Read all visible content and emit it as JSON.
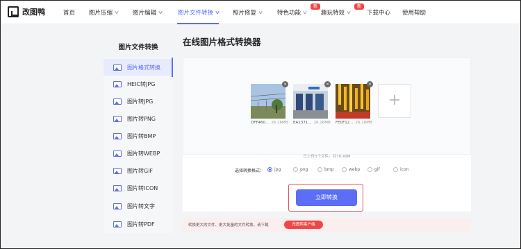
{
  "app": {
    "logo_text": "改图鸭"
  },
  "nav": {
    "items": [
      {
        "label": "首页"
      },
      {
        "label": "图片压缩"
      },
      {
        "label": "图片编辑"
      },
      {
        "label": "图片文件转换"
      },
      {
        "label": "照片修复"
      },
      {
        "label": "特色功能",
        "badge": "新"
      },
      {
        "label": "趣玩特效",
        "badge": "新"
      },
      {
        "label": "下载中心"
      },
      {
        "label": "使用帮助"
      }
    ],
    "active_index": 3
  },
  "sidebar": {
    "title": "图片文件转换",
    "items": [
      {
        "label": "图片格式转换"
      },
      {
        "label": "HEIC转JPG"
      },
      {
        "label": "图片转JPG"
      },
      {
        "label": "图片转PNG"
      },
      {
        "label": "图片转BMP"
      },
      {
        "label": "图片转WEBP"
      },
      {
        "label": "图片转GIF"
      },
      {
        "label": "图片转ICON"
      },
      {
        "label": "图片转文字"
      },
      {
        "label": "图片转PDF"
      }
    ],
    "active_index": 0
  },
  "main": {
    "title": "在线图片格式转换器",
    "files": [
      {
        "name": "DFF460...",
        "size": "26.16MB"
      },
      {
        "name": "EA1371...",
        "size": "26.16MB"
      },
      {
        "name": "FE0F12...",
        "size": "26.16MB"
      }
    ],
    "add_symbol": "+",
    "upload_info": "已上传3个文件，共78.49M",
    "format_label": "选择转换格式：",
    "formats": [
      "jpg",
      "png",
      "bmp",
      "webp",
      "gif",
      "icon"
    ],
    "selected_format": "jpg",
    "convert_button": "立即转换",
    "footer_text": "转换更大的文件、更大批量的文件转换，请下载",
    "footer_button": "改图鸭客户端"
  },
  "colors": {
    "accent": "#5b6ef5",
    "badge": "#f04646",
    "highlight": "#d9574a"
  }
}
